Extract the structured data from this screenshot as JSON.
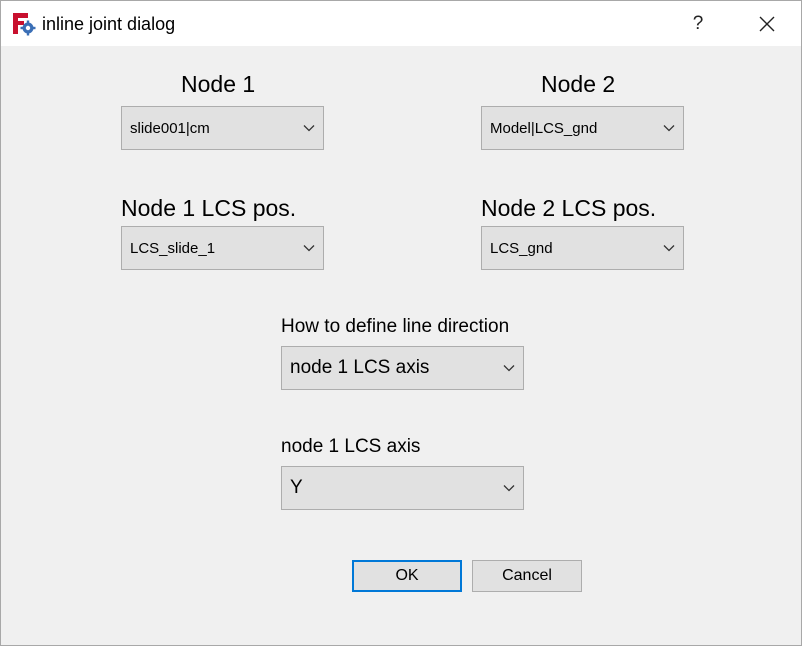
{
  "window": {
    "title": "inline joint dialog",
    "help_label": "?"
  },
  "node1": {
    "label": "Node 1",
    "value": "slide001|cm",
    "lcs_label": "Node 1 LCS pos.",
    "lcs_value": "LCS_slide_1"
  },
  "node2": {
    "label": "Node 2",
    "value": "Model|LCS_gnd",
    "lcs_label": "Node 2 LCS pos.",
    "lcs_value": "LCS_gnd"
  },
  "direction": {
    "label": "How to define line direction",
    "value": "node 1 LCS axis"
  },
  "axis": {
    "label": "node 1 LCS axis",
    "value": "Y"
  },
  "buttons": {
    "ok": "OK",
    "cancel": "Cancel"
  },
  "icons": {
    "app": "freecad-gear-icon",
    "help": "question-mark-icon",
    "close": "close-icon",
    "dropdown": "chevron-down-icon"
  },
  "colors": {
    "accent": "#0078d7",
    "control_bg": "#e1e1e1",
    "dialog_bg": "#f0f0f0"
  }
}
